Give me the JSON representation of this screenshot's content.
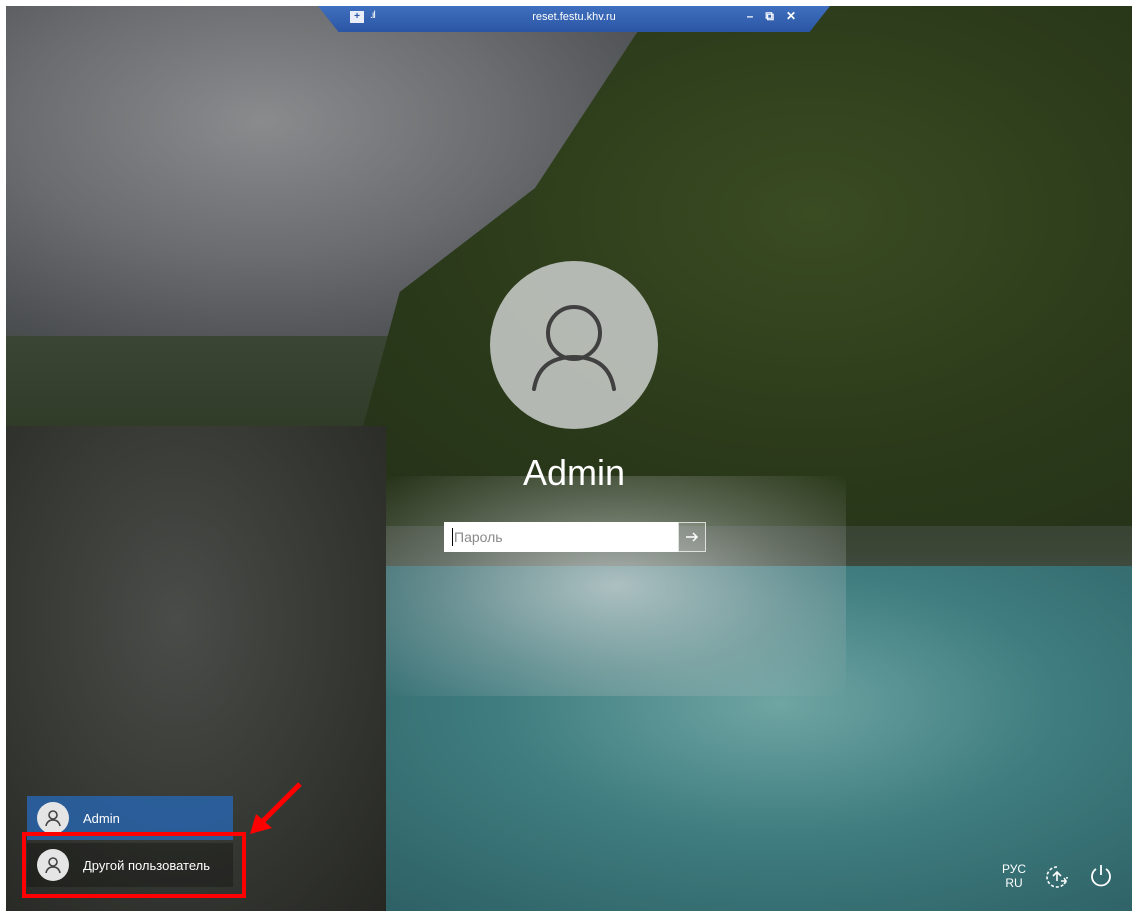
{
  "titlebar": {
    "host": "reset.festu.khv.ru",
    "pin_glyph": "+",
    "signal_glyph": ".ıl",
    "minimize": "–",
    "restore": "⧉",
    "close": "✕"
  },
  "login": {
    "username": "Admin",
    "password_placeholder": "Пароль"
  },
  "users": {
    "items": [
      {
        "label": "Admin",
        "selected": true
      },
      {
        "label": "Другой пользователь",
        "selected": false
      }
    ]
  },
  "corner": {
    "lang_line1": "РУС",
    "lang_line2": "RU"
  },
  "colors": {
    "titlebar": "#2b56a5",
    "selected_user": "#2864aa",
    "highlight": "#ff0000"
  },
  "icons": [
    "user-icon",
    "arrow-right-icon",
    "accessibility-icon",
    "power-icon"
  ]
}
